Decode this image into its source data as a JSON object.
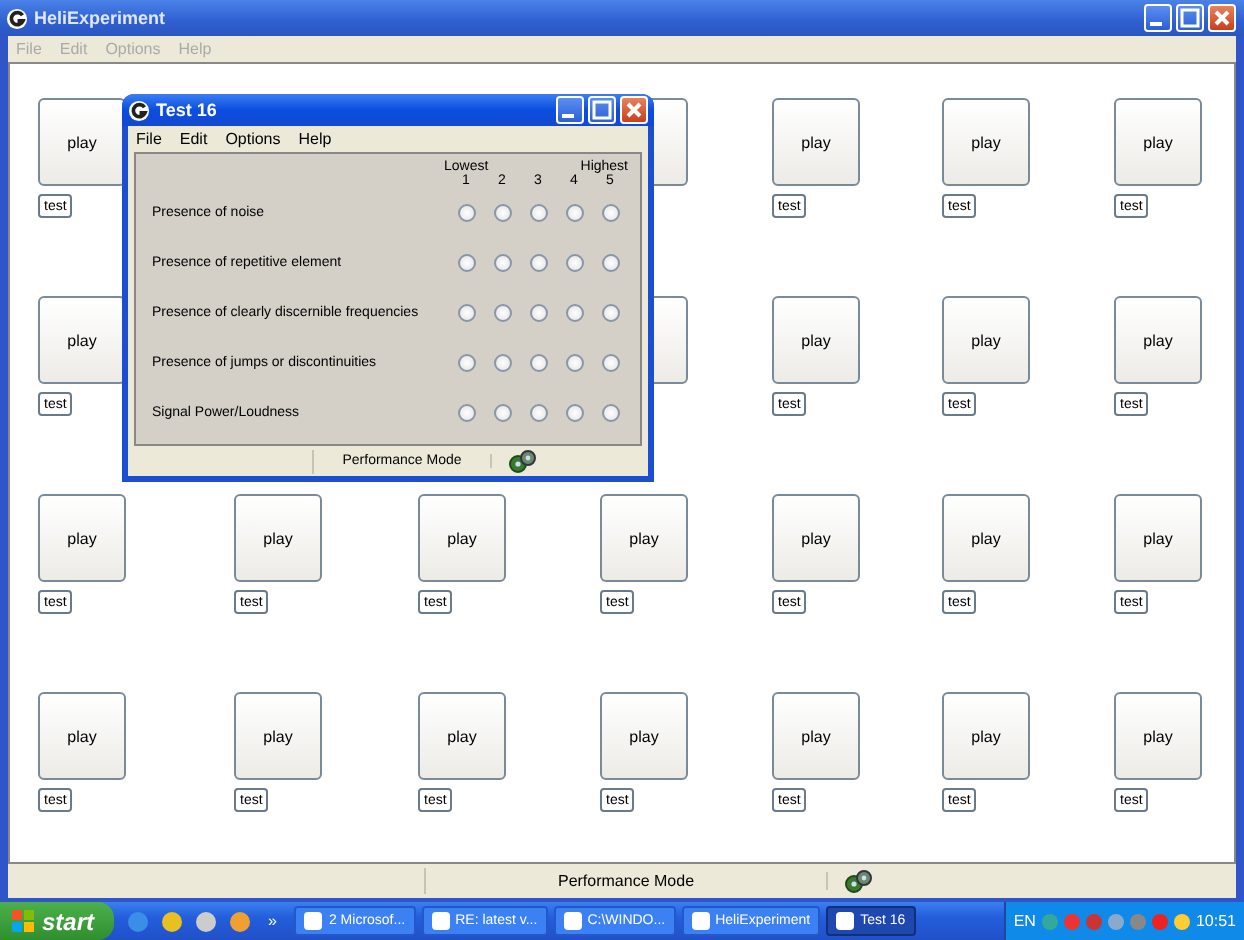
{
  "window": {
    "title": "HeliExperiment",
    "menu": [
      "File",
      "Edit",
      "Options",
      "Help"
    ]
  },
  "grid": {
    "rows": [
      {
        "cells": [
          {
            "play": "play",
            "test": "test"
          },
          {},
          {},
          {},
          {
            "play": "play",
            "test": "test"
          },
          {
            "play": "play",
            "test": "test"
          },
          {
            "play": "play",
            "test": "test"
          }
        ]
      },
      {
        "cells": [
          {
            "play": "play",
            "test": "test"
          },
          {},
          {},
          {},
          {
            "play": "play",
            "test": "test"
          },
          {
            "play": "play",
            "test": "test"
          },
          {
            "play": "play",
            "test": "test"
          }
        ]
      },
      {
        "cells": [
          {
            "play": "play",
            "test": "test"
          },
          {
            "play": "play",
            "test": "test"
          },
          {
            "play": "play",
            "test": "test"
          },
          {
            "play": "play",
            "test": "test"
          },
          {
            "play": "play",
            "test": "test"
          },
          {
            "play": "play",
            "test": "test"
          },
          {
            "play": "play",
            "test": "test"
          }
        ]
      },
      {
        "cells": [
          {
            "play": "play",
            "test": "test"
          },
          {
            "play": "play",
            "test": "test"
          },
          {
            "play": "play",
            "test": "test"
          },
          {
            "play": "play",
            "test": "test"
          },
          {
            "play": "play",
            "test": "test"
          },
          {
            "play": "play",
            "test": "test"
          },
          {
            "play": "play",
            "test": "test"
          }
        ]
      }
    ]
  },
  "status_bar": {
    "mode": "Performance Mode"
  },
  "dialog": {
    "title": "Test 16",
    "menu": [
      "File",
      "Edit",
      "Options",
      "Help"
    ],
    "scale": {
      "low_label": "Lowest",
      "high_label": "Highest",
      "points": [
        "1",
        "2",
        "3",
        "4",
        "5"
      ]
    },
    "questions": [
      {
        "label": "Presence of noise",
        "options": [
          {
            "selected": false
          },
          {
            "selected": false
          },
          {
            "selected": false
          },
          {
            "selected": false
          },
          {
            "selected": false
          }
        ]
      },
      {
        "label": "Presence of repetitive element",
        "options": [
          {
            "selected": false
          },
          {
            "selected": false
          },
          {
            "selected": false
          },
          {
            "selected": false
          },
          {
            "selected": false
          }
        ]
      },
      {
        "label": "Presence of clearly discernible frequencies",
        "options": [
          {
            "selected": false
          },
          {
            "selected": false
          },
          {
            "selected": false
          },
          {
            "selected": false
          },
          {
            "selected": false
          }
        ]
      },
      {
        "label": "Presence of jumps or discontinuities",
        "options": [
          {
            "selected": false
          },
          {
            "selected": false
          },
          {
            "selected": false
          },
          {
            "selected": false
          },
          {
            "selected": false
          }
        ]
      },
      {
        "label": "Signal Power/Loudness",
        "options": [
          {
            "selected": false
          },
          {
            "selected": false
          },
          {
            "selected": false
          },
          {
            "selected": false
          },
          {
            "selected": false
          }
        ]
      }
    ],
    "status_bar": {
      "mode": "Performance Mode"
    }
  },
  "taskbar": {
    "start": "start",
    "more": "»",
    "tasks": [
      {
        "label": "2 Microsof...",
        "selected": false
      },
      {
        "label": "RE: latest v...",
        "selected": false
      },
      {
        "label": "C:\\WINDO...",
        "selected": false
      },
      {
        "label": "HeliExperiment",
        "selected": false
      },
      {
        "label": "Test 16",
        "selected": true
      }
    ],
    "language": "EN",
    "time": "10:51"
  }
}
